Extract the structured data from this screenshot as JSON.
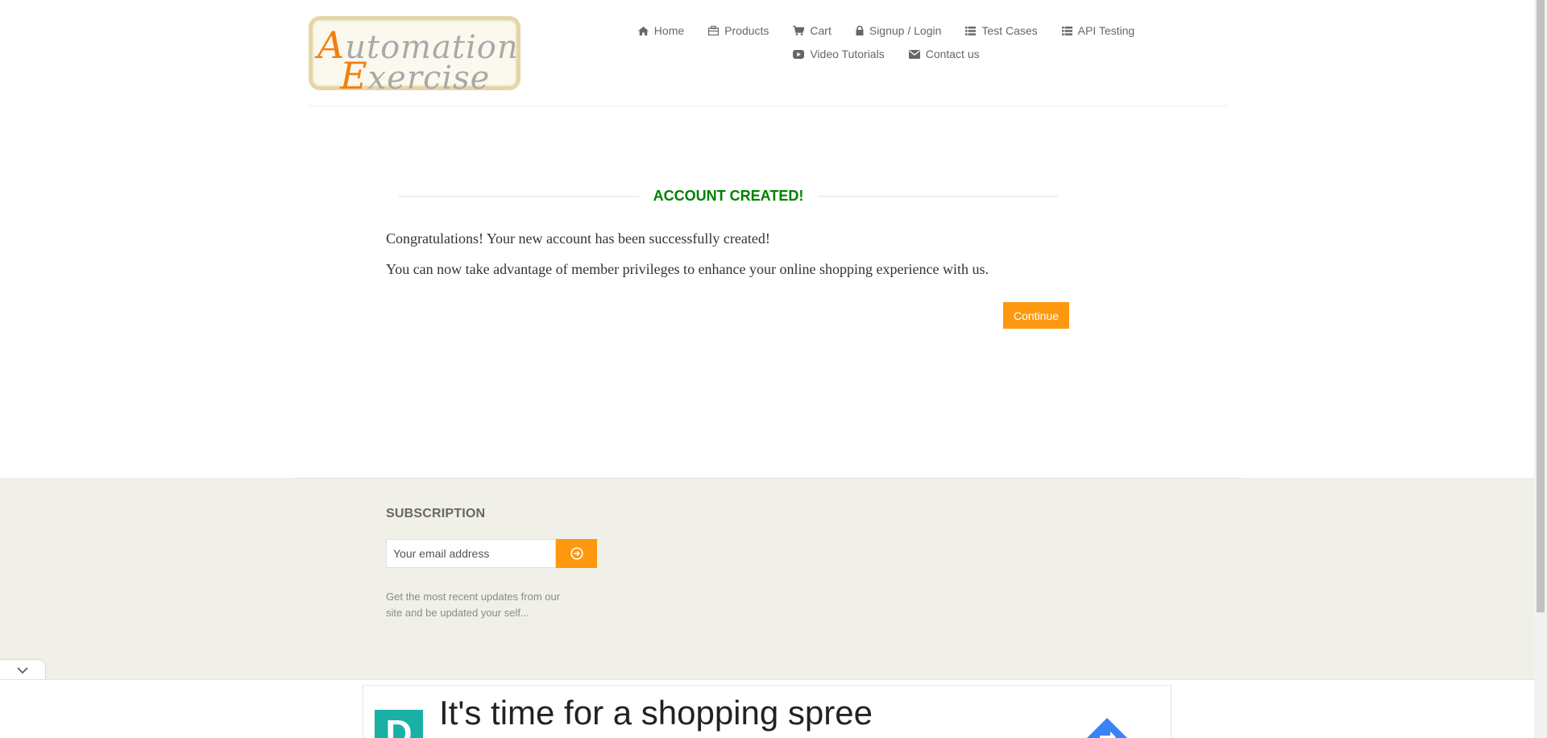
{
  "logo": {
    "line1_initial": "A",
    "line1_rest": "utomation",
    "line2_initial": "E",
    "line2_rest": "xercise"
  },
  "nav": {
    "row1": [
      {
        "label": "Home",
        "icon": "home-icon"
      },
      {
        "label": "Products",
        "icon": "products-icon"
      },
      {
        "label": "Cart",
        "icon": "cart-icon"
      },
      {
        "label": "Signup / Login",
        "icon": "lock-icon"
      },
      {
        "label": "Test Cases",
        "icon": "list-icon"
      },
      {
        "label": "API Testing",
        "icon": "list-icon"
      }
    ],
    "row2": [
      {
        "label": "Video Tutorials",
        "icon": "youtube-play-icon"
      },
      {
        "label": "Contact us",
        "icon": "envelope-icon"
      }
    ]
  },
  "main": {
    "title": "ACCOUNT CREATED!",
    "message1": "Congratulations! Your new account has been successfully created!",
    "message2": "You can now take advantage of member privileges to enhance your online shopping experience with us.",
    "continue_label": "Continue"
  },
  "footer": {
    "subscription_title": "SUBSCRIPTION",
    "email_placeholder": "Your email address",
    "description": "Get the most recent updates from our site and be updated your self..."
  },
  "ad": {
    "headline": "It's time for a shopping spree",
    "logo_letter": "D"
  },
  "colors": {
    "accent": "#fe980f",
    "success": "#008000",
    "text": "#696763",
    "footer_bg": "#f0f0e9"
  }
}
